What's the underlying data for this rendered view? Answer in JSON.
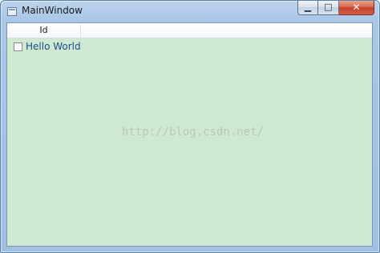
{
  "window": {
    "title": "MainWindow",
    "buttons": {
      "minimize": "▁",
      "maximize": "□",
      "close": "✕"
    }
  },
  "grid": {
    "columns": [
      {
        "header": "Id"
      }
    ],
    "rows": [
      {
        "label": "Hello World",
        "checked": false
      }
    ]
  },
  "watermark": "http://blog.csdn.net/",
  "colors": {
    "client_background": "#cfe8d1",
    "row_text": "#1f4e8c",
    "titlebar": "#a9c6e6",
    "close_button": "#c7402a"
  },
  "icons": {
    "app": "window-icon",
    "minimize": "minimize-icon",
    "maximize": "maximize-icon",
    "close": "close-icon"
  }
}
